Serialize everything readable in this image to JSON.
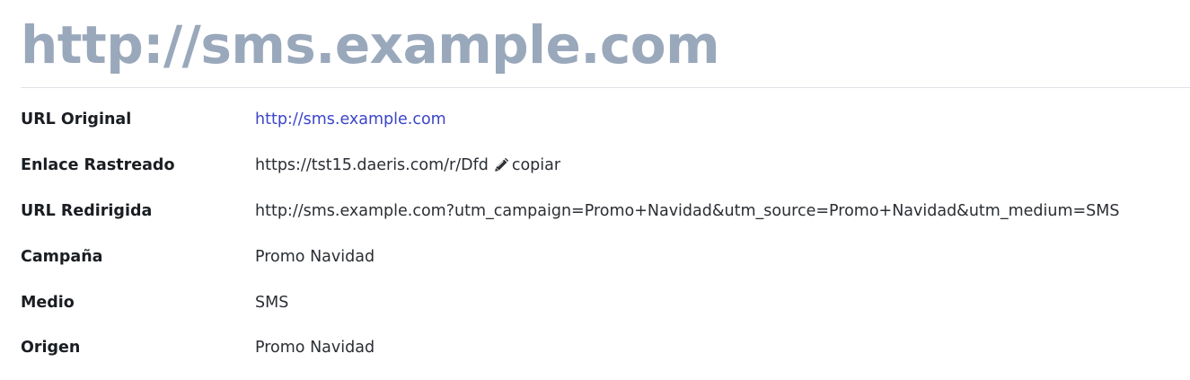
{
  "page": {
    "title": "http://sms.example.com"
  },
  "details": {
    "original_url": {
      "label": "URL Original",
      "value": "http://sms.example.com"
    },
    "tracked_link": {
      "label": "Enlace Rastreado",
      "value": "https://tst15.daeris.com/r/Dfd",
      "edit_icon": "pencil-icon",
      "copy_label": "copiar"
    },
    "redirected_url": {
      "label": "URL Redirigida",
      "value": "http://sms.example.com?utm_campaign=Promo+Navidad&utm_source=Promo+Navidad&utm_medium=SMS"
    },
    "campaign": {
      "label": "Campaña",
      "value": "Promo Navidad"
    },
    "medium": {
      "label": "Medio",
      "value": "SMS"
    },
    "source": {
      "label": "Origen",
      "value": "Promo Navidad"
    }
  },
  "colors": {
    "title": "#9aa8bb",
    "link": "#3b45c8",
    "divider": "#dee2e6",
    "text": "#212529"
  }
}
